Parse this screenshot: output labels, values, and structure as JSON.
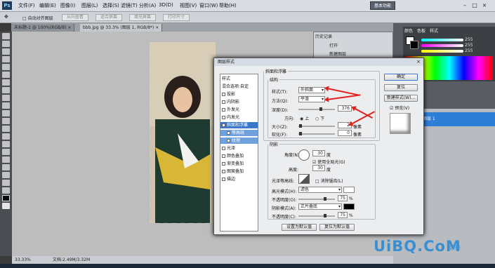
{
  "app": {
    "logo": "Ps",
    "workspace": "基本功能"
  },
  "menu": [
    "文件(F)",
    "编辑(E)",
    "图像(I)",
    "图层(L)",
    "选择(S)",
    "滤镜(T)",
    "分析(A)",
    "3D(D)",
    "视图(V)",
    "窗口(W)",
    "帮助(H)"
  ],
  "options": {
    "checkbox_label": "□ 自动对齐图层",
    "buttons": [
      "从向查看",
      "适合屏幕",
      "填充屏幕",
      "打印尺寸"
    ]
  },
  "tabs": [
    {
      "label": "未标题-1 @ 100%(RGB/8) ×"
    },
    {
      "label": "bbb.jpg @ 33.3% (图层 1, RGB/8*) ×"
    }
  ],
  "history": {
    "title": "历史记录",
    "items": [
      "打开",
      "新建图层"
    ]
  },
  "color_panel": {
    "tabs": [
      "颜色",
      "色板",
      "样式"
    ],
    "values": [
      "255",
      "255",
      "255"
    ]
  },
  "layers": {
    "selected": "图层 1"
  },
  "status": {
    "zoom": "33.33%",
    "doc": "文档:2.49M/3.32M"
  },
  "dialog": {
    "title": "图层样式",
    "close": "×",
    "styles": [
      {
        "label": "样式",
        "type": "plain"
      },
      {
        "label": "混合选项:自定",
        "type": "plain"
      },
      {
        "label": "投影",
        "type": "check"
      },
      {
        "label": "内阴影",
        "type": "check"
      },
      {
        "label": "外发光",
        "type": "check"
      },
      {
        "label": "内发光",
        "type": "check"
      },
      {
        "label": "斜面和浮雕",
        "type": "selected"
      },
      {
        "label": "等高线",
        "type": "sub"
      },
      {
        "label": "纹理",
        "type": "sub"
      },
      {
        "label": "光泽",
        "type": "check"
      },
      {
        "label": "颜色叠加",
        "type": "check"
      },
      {
        "label": "渐变叠加",
        "type": "check"
      },
      {
        "label": "图案叠加",
        "type": "check"
      },
      {
        "label": "描边",
        "type": "check"
      }
    ],
    "bevel": {
      "legend": "斜面和浮雕",
      "structure": "结构",
      "style_label": "样式(T):",
      "style_value": "外斜面",
      "method_label": "方法(Q):",
      "method_value": "平滑",
      "depth_label": "深度(D):",
      "depth_value": "376",
      "pct": "%",
      "direction_label": "方向:",
      "dir_up": "上",
      "dir_down": "下",
      "size_label": "大小(Z):",
      "size_value": "2",
      "px": "像素",
      "soften_label": "软化(F):",
      "soften_value": "0",
      "px2": "像素"
    },
    "shading": {
      "legend": "阴影",
      "angle_label": "角度(N):",
      "angle_value": "30",
      "deg": "度",
      "global_light": "使用全局光(G)",
      "altitude_label": "高度:",
      "altitude_value": "30",
      "deg2": "度",
      "gloss_label": "光泽等高线:",
      "antialias": "消除锯齿(L)",
      "highlight_label": "高光模式(H):",
      "highlight_value": "滤色",
      "opacity1_label": "不透明度(O):",
      "opacity1_value": "75",
      "pct1": "%",
      "shadow_label": "阴影模式(A):",
      "shadow_value": "正片叠底",
      "opacity2_label": "不透明度(C):",
      "opacity2_value": "75",
      "pct2": "%"
    },
    "default_btn": "设置为默认值",
    "reset_btn": "复位为默认值",
    "ok": "确定",
    "cancel": "复位",
    "new_style": "新建样式(W)...",
    "preview": "预览(V)"
  },
  "watermark": {
    "main": "UiBQ.CoM",
    "sub": "思缘"
  },
  "colors": {
    "accent": "#3877c9",
    "arrow": "#e3211c",
    "watermark": "#3a8fd0"
  }
}
